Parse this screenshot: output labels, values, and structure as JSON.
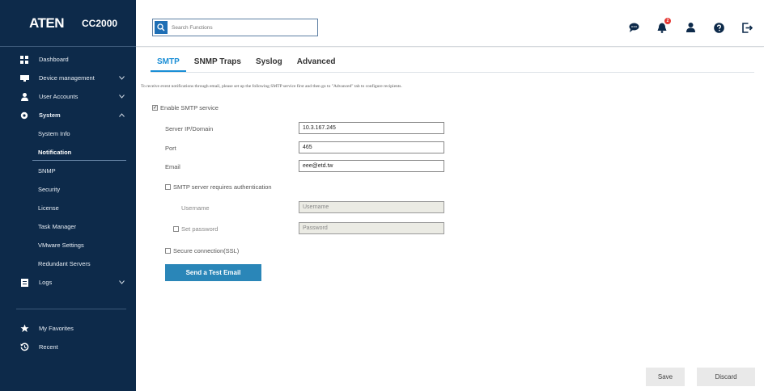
{
  "brand": {
    "logo": "ATEN",
    "model": "CC2000"
  },
  "sidebar": {
    "items": [
      {
        "label": "Dashboard",
        "icon": "dashboard-icon"
      },
      {
        "label": "Device management",
        "icon": "device-icon",
        "expand": "chevron-down"
      },
      {
        "label": "User Accounts",
        "icon": "user-icon",
        "expand": "chevron-down"
      },
      {
        "label": "System",
        "icon": "gear-icon",
        "expand": "chevron-up"
      }
    ],
    "system_sub": [
      {
        "label": "System Info"
      },
      {
        "label": "Notification",
        "active": true
      },
      {
        "label": "SNMP"
      },
      {
        "label": "Security"
      },
      {
        "label": "License"
      },
      {
        "label": "Task Manager"
      },
      {
        "label": "VMware Settings"
      },
      {
        "label": "Redundant Servers"
      }
    ],
    "logs": {
      "label": "Logs",
      "icon": "logs-icon",
      "expand": "chevron-down"
    },
    "bottom": [
      {
        "label": "My Favorites",
        "icon": "star-icon"
      },
      {
        "label": "Recent",
        "icon": "history-icon"
      }
    ]
  },
  "topbar": {
    "search_placeholder": "Search Functions",
    "notification_count": "2",
    "icons": [
      "chat-icon",
      "bell-icon",
      "user-icon",
      "help-icon",
      "logout-icon"
    ]
  },
  "tabs": [
    {
      "label": "SMTP",
      "active": true
    },
    {
      "label": "SNMP Traps"
    },
    {
      "label": "Syslog"
    },
    {
      "label": "Advanced"
    }
  ],
  "smtp": {
    "intro": "To receive event notifications through email, please set up the following SMTP service first and then go to \"Advanced\" tab to configure recipients.",
    "enable_label": "Enable SMTP service",
    "enable_checked": true,
    "server_label": "Server IP/Domain",
    "server_value": "10.3.167.245",
    "port_label": "Port",
    "port_value": "465",
    "email_label": "Email",
    "email_value": "eee@etd.tw",
    "auth_label": "SMTP server requires authentication",
    "auth_checked": false,
    "username_label": "Username",
    "username_placeholder": "Username",
    "setpw_label": "Set password",
    "password_placeholder": "Password",
    "ssl_label": "Secure connection(SSL)",
    "ssl_checked": false,
    "test_button": "Send a Test Email"
  },
  "footer": {
    "save": "Save",
    "discard": "Discard"
  },
  "colors": {
    "sidebar": "#0d2a4a",
    "accent": "#1a8ed6",
    "button": "#2a86b8"
  }
}
